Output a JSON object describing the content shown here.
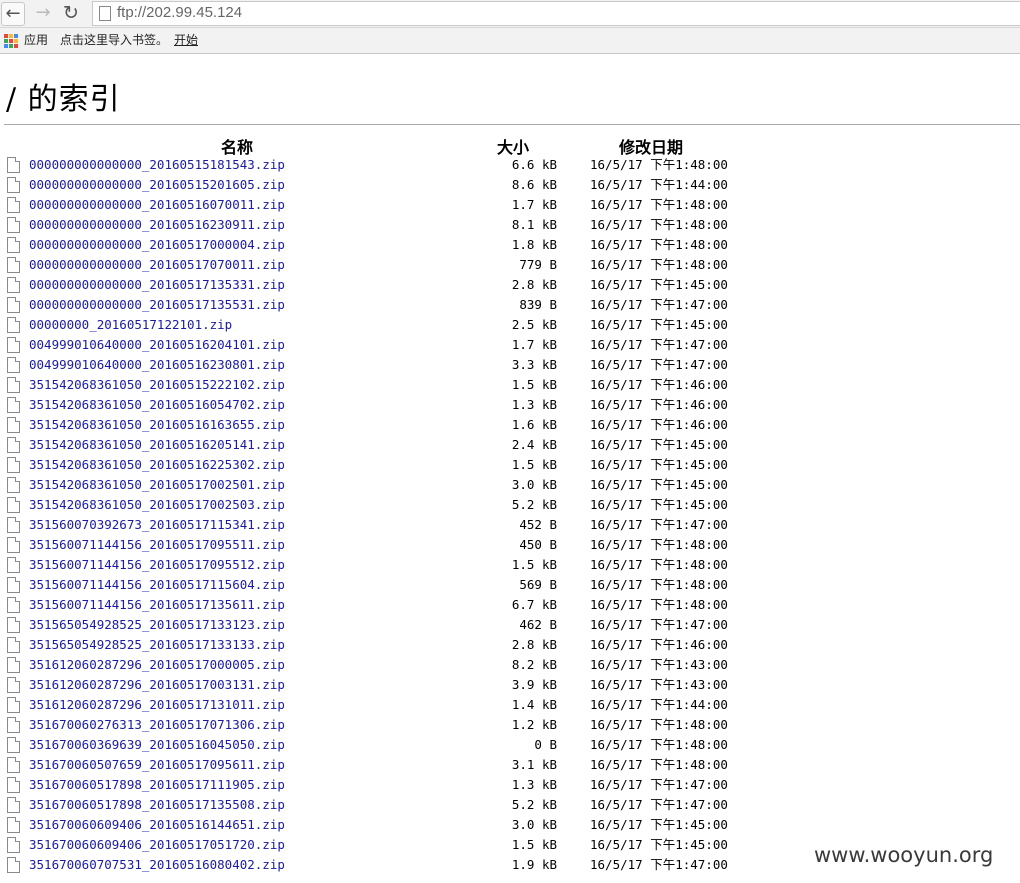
{
  "browser": {
    "url": "ftp://202.99.45.124",
    "bookmarks": {
      "apps_label": "应用",
      "hint": "点击这里导入书签。",
      "start_link": "开始"
    },
    "apps_icon_colors": [
      "#e8453c",
      "#f9bb2d",
      "#4688f1",
      "#3aa757",
      "#e8453c",
      "#f9bb2d",
      "#4688f1",
      "#3aa757",
      "#e8453c"
    ]
  },
  "page": {
    "heading": "/ 的索引",
    "columns": {
      "name": "名称",
      "size": "大小",
      "date": "修改日期"
    },
    "files": [
      {
        "name": "000000000000000_20160515181543.zip",
        "size": "6.6 kB",
        "date": "16/5/17 下午1:48:00"
      },
      {
        "name": "000000000000000_20160515201605.zip",
        "size": "8.6 kB",
        "date": "16/5/17 下午1:44:00"
      },
      {
        "name": "000000000000000_20160516070011.zip",
        "size": "1.7 kB",
        "date": "16/5/17 下午1:48:00"
      },
      {
        "name": "000000000000000_20160516230911.zip",
        "size": "8.1 kB",
        "date": "16/5/17 下午1:48:00"
      },
      {
        "name": "000000000000000_20160517000004.zip",
        "size": "1.8 kB",
        "date": "16/5/17 下午1:48:00"
      },
      {
        "name": "000000000000000_20160517070011.zip",
        "size": "779 B",
        "date": "16/5/17 下午1:48:00"
      },
      {
        "name": "000000000000000_20160517135331.zip",
        "size": "2.8 kB",
        "date": "16/5/17 下午1:45:00"
      },
      {
        "name": "000000000000000_20160517135531.zip",
        "size": "839 B",
        "date": "16/5/17 下午1:47:00"
      },
      {
        "name": "00000000_20160517122101.zip",
        "size": "2.5 kB",
        "date": "16/5/17 下午1:45:00"
      },
      {
        "name": "004999010640000_20160516204101.zip",
        "size": "1.7 kB",
        "date": "16/5/17 下午1:47:00"
      },
      {
        "name": "004999010640000_20160516230801.zip",
        "size": "3.3 kB",
        "date": "16/5/17 下午1:47:00"
      },
      {
        "name": "351542068361050_20160515222102.zip",
        "size": "1.5 kB",
        "date": "16/5/17 下午1:46:00"
      },
      {
        "name": "351542068361050_20160516054702.zip",
        "size": "1.3 kB",
        "date": "16/5/17 下午1:46:00"
      },
      {
        "name": "351542068361050_20160516163655.zip",
        "size": "1.6 kB",
        "date": "16/5/17 下午1:46:00"
      },
      {
        "name": "351542068361050_20160516205141.zip",
        "size": "2.4 kB",
        "date": "16/5/17 下午1:45:00"
      },
      {
        "name": "351542068361050_20160516225302.zip",
        "size": "1.5 kB",
        "date": "16/5/17 下午1:45:00"
      },
      {
        "name": "351542068361050_20160517002501.zip",
        "size": "3.0 kB",
        "date": "16/5/17 下午1:45:00"
      },
      {
        "name": "351542068361050_20160517002503.zip",
        "size": "5.2 kB",
        "date": "16/5/17 下午1:45:00"
      },
      {
        "name": "351560070392673_20160517115341.zip",
        "size": "452 B",
        "date": "16/5/17 下午1:47:00"
      },
      {
        "name": "351560071144156_20160517095511.zip",
        "size": "450 B",
        "date": "16/5/17 下午1:48:00"
      },
      {
        "name": "351560071144156_20160517095512.zip",
        "size": "1.5 kB",
        "date": "16/5/17 下午1:48:00"
      },
      {
        "name": "351560071144156_20160517115604.zip",
        "size": "569 B",
        "date": "16/5/17 下午1:48:00"
      },
      {
        "name": "351560071144156_20160517135611.zip",
        "size": "6.7 kB",
        "date": "16/5/17 下午1:48:00"
      },
      {
        "name": "351565054928525_20160517133123.zip",
        "size": "462 B",
        "date": "16/5/17 下午1:47:00"
      },
      {
        "name": "351565054928525_20160517133133.zip",
        "size": "2.8 kB",
        "date": "16/5/17 下午1:46:00"
      },
      {
        "name": "351612060287296_20160517000005.zip",
        "size": "8.2 kB",
        "date": "16/5/17 下午1:43:00"
      },
      {
        "name": "351612060287296_20160517003131.zip",
        "size": "3.9 kB",
        "date": "16/5/17 下午1:43:00"
      },
      {
        "name": "351612060287296_20160517131011.zip",
        "size": "1.4 kB",
        "date": "16/5/17 下午1:44:00"
      },
      {
        "name": "351670060276313_20160517071306.zip",
        "size": "1.2 kB",
        "date": "16/5/17 下午1:48:00"
      },
      {
        "name": "351670060369639_20160516045050.zip",
        "size": "0 B",
        "date": "16/5/17 下午1:48:00"
      },
      {
        "name": "351670060507659_20160517095611.zip",
        "size": "3.1 kB",
        "date": "16/5/17 下午1:48:00"
      },
      {
        "name": "351670060517898_20160517111905.zip",
        "size": "1.3 kB",
        "date": "16/5/17 下午1:47:00"
      },
      {
        "name": "351670060517898_20160517135508.zip",
        "size": "5.2 kB",
        "date": "16/5/17 下午1:47:00"
      },
      {
        "name": "351670060609406_20160516144651.zip",
        "size": "3.0 kB",
        "date": "16/5/17 下午1:45:00"
      },
      {
        "name": "351670060609406_20160517051720.zip",
        "size": "1.5 kB",
        "date": "16/5/17 下午1:45:00"
      },
      {
        "name": "351670060707531_20160516080402.zip",
        "size": "1.9 kB",
        "date": "16/5/17 下午1:47:00"
      }
    ]
  },
  "watermark": "www.wooyun.org"
}
